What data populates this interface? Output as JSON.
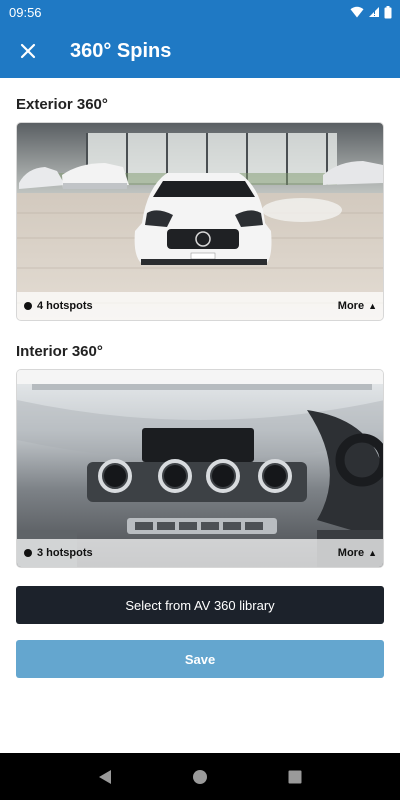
{
  "status_bar": {
    "time": "09:56"
  },
  "app_bar": {
    "title": "360° Spins"
  },
  "sections": [
    {
      "title": "Exterior 360°",
      "hotspots": "4 hotspots",
      "more": "More"
    },
    {
      "title": "Interior 360°",
      "hotspots": "3 hotspots",
      "more": "More"
    }
  ],
  "buttons": {
    "library": "Select from AV 360 library",
    "save": "Save"
  },
  "colors": {
    "primary": "#1f79c4",
    "dark_button": "#1c222b",
    "save_button": "#64a6cf"
  },
  "icons": [
    "close-icon",
    "wifi-icon",
    "signal-icon",
    "battery-icon",
    "back-icon",
    "home-icon",
    "recents-icon",
    "caret-up-icon"
  ]
}
